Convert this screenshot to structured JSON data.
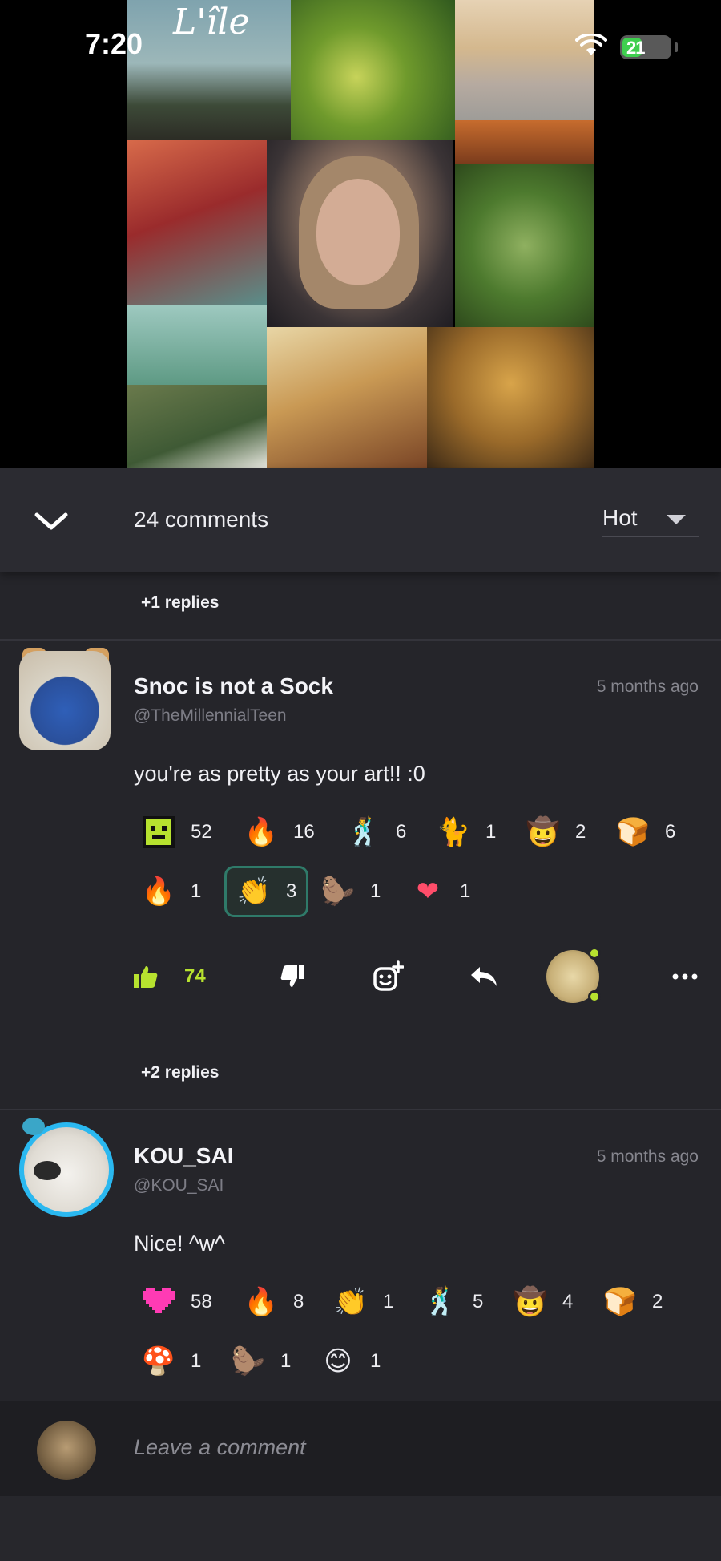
{
  "status_bar": {
    "time": "7:20",
    "battery": "21"
  },
  "header_art": {
    "title": "L'île"
  },
  "comments_header": {
    "count_label": "24 comments",
    "sort": "Hot"
  },
  "replies_top": "+1 replies",
  "comments": [
    {
      "username": "Snoc is not a Sock",
      "handle": "@TheMillennialTeen",
      "time": "5 months ago",
      "text": "you're as pretty as your art!! :0",
      "reactions_row1": [
        {
          "icon": "green-pixel-face",
          "count": "52"
        },
        {
          "icon": "fire-pixel",
          "count": "16"
        },
        {
          "icon": "dancing-figure",
          "count": "6"
        },
        {
          "icon": "cat-sticker",
          "count": "1"
        },
        {
          "icon": "cowboy-face",
          "count": "2"
        },
        {
          "icon": "bread",
          "count": "6"
        }
      ],
      "reactions_row2": [
        {
          "icon": "fire",
          "count": "1"
        },
        {
          "icon": "clapping-hands",
          "count": "3"
        },
        {
          "icon": "beaver",
          "count": "1"
        },
        {
          "icon": "heart",
          "count": "1"
        }
      ],
      "likes": "74",
      "replies_label": "+2 replies"
    },
    {
      "username": "KOU_SAI",
      "handle": "@KOU_SAI",
      "time": "5 months ago",
      "text": "Nice! ^w^",
      "reactions_row1": [
        {
          "icon": "pink-pixel-heart",
          "count": "58"
        },
        {
          "icon": "fire-pixel",
          "count": "8"
        },
        {
          "icon": "clapping-hands-green",
          "count": "1"
        },
        {
          "icon": "dancing-figure",
          "count": "5"
        },
        {
          "icon": "cowboy-face",
          "count": "4"
        },
        {
          "icon": "bread",
          "count": "2"
        }
      ],
      "reactions_row2": [
        {
          "icon": "dancing-mushroom",
          "count": "1"
        },
        {
          "icon": "beaver",
          "count": "1"
        },
        {
          "icon": "smiling-face",
          "count": "1"
        }
      ]
    }
  ],
  "leave_comment": {
    "placeholder": "Leave a comment"
  },
  "colors": {
    "accent_green": "#b7e22f",
    "background": "#25252a",
    "selected_border": "#2f7a69"
  }
}
